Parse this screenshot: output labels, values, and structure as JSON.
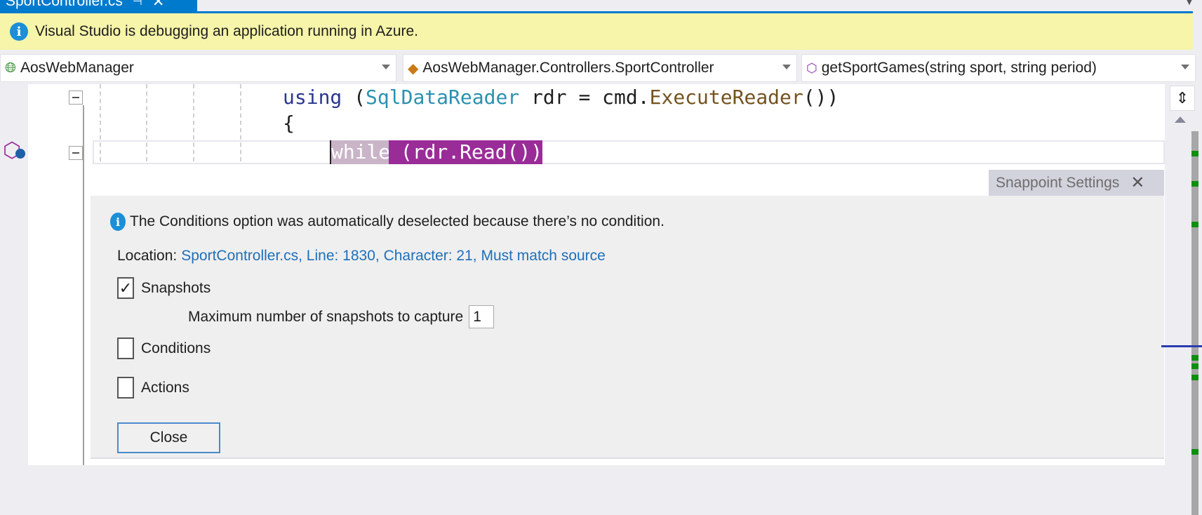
{
  "tab": {
    "title": "SportController.cs",
    "pin_icon": "pin-icon",
    "close_icon": "close-icon"
  },
  "infobar": {
    "message": "Visual Studio is debugging an application running in Azure.",
    "icon": "info-icon"
  },
  "navbar": {
    "project": "AosWebManager",
    "class": "AosWebManager.Controllers.SportController",
    "member": "getSportGames(string sport, string period)"
  },
  "code": {
    "line1": {
      "kw": "using",
      "p1": " (",
      "type": "SqlDataReader",
      "p2": " rdr = cmd.",
      "method": "ExecuteReader",
      "p3": "())"
    },
    "line2": "{",
    "line3_kw": "while",
    "line3_rest": " (rdr.Read())"
  },
  "snappoint": {
    "title": "Snappoint Settings",
    "notice": "The Conditions option was automatically deselected because there’s no condition.",
    "location_label": "Location:",
    "location_value": "SportController.cs, Line: 1830, Character: 21, Must match source",
    "snapshots_label": "Snapshots",
    "snapshots_checked": true,
    "max_label": "Maximum number of snapshots to capture",
    "max_value": "1",
    "conditions_label": "Conditions",
    "conditions_checked": false,
    "actions_label": "Actions",
    "actions_checked": false,
    "close_label": "Close",
    "check_mark": "✓"
  },
  "colors": {
    "accent": "#007acc",
    "infobar": "#f6f5a9",
    "highlight": "#9a2c98",
    "link": "#1e6fba"
  }
}
